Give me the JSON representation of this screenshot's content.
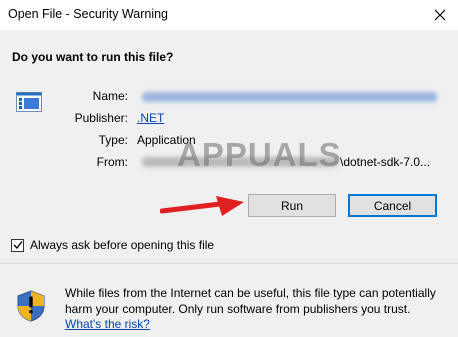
{
  "window": {
    "title": "Open File - Security Warning"
  },
  "dialog": {
    "question": "Do you want to run this file?",
    "fields": {
      "name_label": "Name:",
      "publisher_label": "Publisher:",
      "publisher_value": ".NET",
      "type_label": "Type:",
      "type_value": "Application",
      "from_label": "From:",
      "from_value_tail": "\\dotnet-sdk-7.0..."
    },
    "buttons": {
      "run": "Run",
      "cancel": "Cancel"
    },
    "checkbox": {
      "label": "Always ask before opening this file",
      "checked": true
    },
    "info_text": "While files from the Internet can be useful, this file type can potentially harm your computer. Only run software from publishers you trust.",
    "info_link": "What's the risk?",
    "watermark": "APPUALS"
  },
  "icons": {
    "close": "close-icon",
    "app": "application-icon",
    "shield": "security-shield-icon",
    "arrow": "red-arrow-pointer"
  },
  "colors": {
    "link": "#0645ad",
    "primary_button_border": "#0078d7",
    "arrow": "#e02020"
  }
}
